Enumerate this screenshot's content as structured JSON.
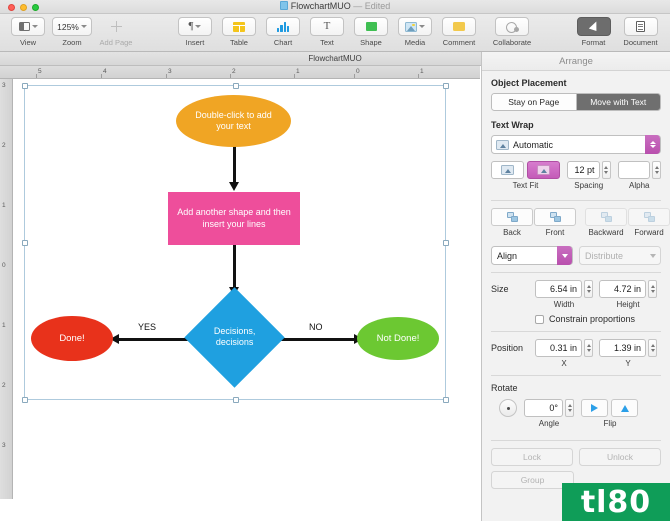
{
  "window": {
    "title": "FlowchartMUO",
    "status": "— Edited",
    "doc_name_bar": "FlowchartMUO"
  },
  "toolbar": {
    "left_items": [
      {
        "label": "View",
        "icon": "view-icon",
        "has_chevron": true,
        "enabled": true
      },
      {
        "label": "Zoom",
        "icon": "zoom-value",
        "value": "125%",
        "has_chevron": true,
        "enabled": true
      },
      {
        "label": "Add Page",
        "icon": "plus-icon",
        "has_chevron": false,
        "enabled": false
      }
    ],
    "center_items": [
      {
        "label": "Insert",
        "icon": "paragraph-icon",
        "has_chevron": true
      },
      {
        "label": "Table",
        "icon": "table-icon",
        "has_chevron": false
      },
      {
        "label": "Chart",
        "icon": "chart-icon",
        "has_chevron": false
      },
      {
        "label": "Text",
        "icon": "text-icon",
        "has_chevron": false
      },
      {
        "label": "Shape",
        "icon": "shape-icon",
        "has_chevron": false
      },
      {
        "label": "Media",
        "icon": "media-icon",
        "has_chevron": true
      },
      {
        "label": "Comment",
        "icon": "comment-icon",
        "has_chevron": false
      }
    ],
    "collaborate": {
      "label": "Collaborate",
      "icon": "collaborate-icon"
    },
    "right_items": [
      {
        "label": "Format",
        "icon": "format-brush-icon",
        "active": true
      },
      {
        "label": "Document",
        "icon": "document-icon",
        "active": false
      }
    ]
  },
  "rulers": {
    "horizontal_ticks": [
      "5",
      "4",
      "3",
      "2",
      "1",
      "0",
      "1"
    ],
    "vertical_ticks": [
      "3",
      "2",
      "1",
      "0",
      "1",
      "2",
      "3"
    ]
  },
  "chart_data": {
    "type": "diagram",
    "title": "FlowchartMUO",
    "nodes": [
      {
        "id": "start",
        "shape": "ellipse",
        "label": "Double-click to add your text",
        "color": "#F0A524"
      },
      {
        "id": "process",
        "shape": "rect",
        "label": "Add another shape and then insert your lines",
        "color": "#EE4E9B"
      },
      {
        "id": "decision",
        "shape": "diamond",
        "label": "Decisions, decisions",
        "color": "#1FA0E0"
      },
      {
        "id": "done",
        "shape": "ellipse",
        "label": "Done!",
        "color": "#E8321B"
      },
      {
        "id": "notdone",
        "shape": "ellipse",
        "label": "Not Done!",
        "color": "#6CC832"
      }
    ],
    "edges": [
      {
        "from": "start",
        "to": "process",
        "label": "",
        "direction": "down"
      },
      {
        "from": "process",
        "to": "decision",
        "label": "",
        "direction": "down"
      },
      {
        "from": "decision",
        "to": "done",
        "label": "YES",
        "direction": "left"
      },
      {
        "from": "decision",
        "to": "notdone",
        "label": "NO",
        "direction": "right"
      }
    ]
  },
  "sidebar": {
    "header": "Arrange",
    "object_placement": {
      "title": "Object Placement",
      "options": [
        "Stay on Page",
        "Move with Text"
      ],
      "selected": "Move with Text"
    },
    "text_wrap": {
      "title": "Text Wrap",
      "mode": "Automatic",
      "text_fit_label": "Text Fit",
      "spacing_label": "Spacing",
      "spacing_value": "12 pt",
      "alpha_label": "Alpha",
      "alpha_value": ""
    },
    "arrange_buttons": [
      {
        "label": "Back",
        "enabled": true
      },
      {
        "label": "Front",
        "enabled": true
      },
      {
        "label": "Backward",
        "enabled": false
      },
      {
        "label": "Forward",
        "enabled": false
      }
    ],
    "align_row": {
      "align_label": "Align",
      "distribute_label": "Distribute",
      "distribute_enabled": false
    },
    "size": {
      "title": "Size",
      "width_value": "6.54 in",
      "width_label": "Width",
      "height_value": "4.72 in",
      "height_label": "Height",
      "constrain_label": "Constrain proportions",
      "constrain_checked": false
    },
    "position": {
      "title": "Position",
      "x_value": "0.31 in",
      "x_label": "X",
      "y_value": "1.39 in",
      "y_label": "Y"
    },
    "rotate": {
      "title": "Rotate",
      "angle_value": "0°",
      "angle_label": "Angle",
      "flip_label": "Flip"
    },
    "bottom_buttons": [
      {
        "label": "Lock",
        "enabled": false
      },
      {
        "label": "Unlock",
        "enabled": false
      },
      {
        "label": "Group",
        "enabled": false
      }
    ]
  },
  "watermark": {
    "text": "tl80",
    "color": "#0f9d58"
  }
}
